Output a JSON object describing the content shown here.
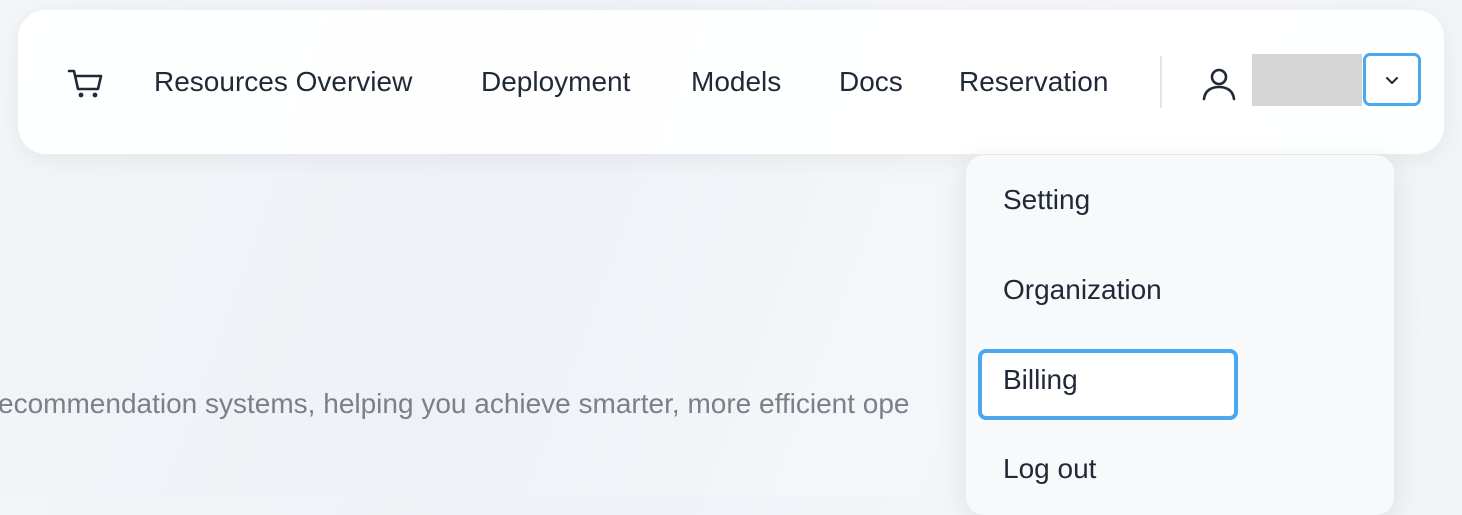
{
  "nav": {
    "cart_icon": "cart-icon",
    "links": [
      {
        "label": "Resources Overview"
      },
      {
        "label": "Deployment"
      },
      {
        "label": "Models"
      },
      {
        "label": "Docs"
      },
      {
        "label": "Reservation"
      }
    ],
    "user_icon": "user-icon",
    "user_name": "",
    "dropdown_icon": "chevron-down-icon"
  },
  "hero": {
    "text": "ecommendation systems, helping you achieve smarter, more efficient ope"
  },
  "user_menu": {
    "items": [
      {
        "label": "Setting"
      },
      {
        "label": "Organization"
      },
      {
        "label": "Billing"
      },
      {
        "label": "Log out"
      }
    ],
    "highlighted": "Billing"
  },
  "colors": {
    "accent": "#4aa8f0",
    "text": "#1f2937",
    "muted_text": "#7b8088",
    "placeholder": "#d5d5d5"
  }
}
